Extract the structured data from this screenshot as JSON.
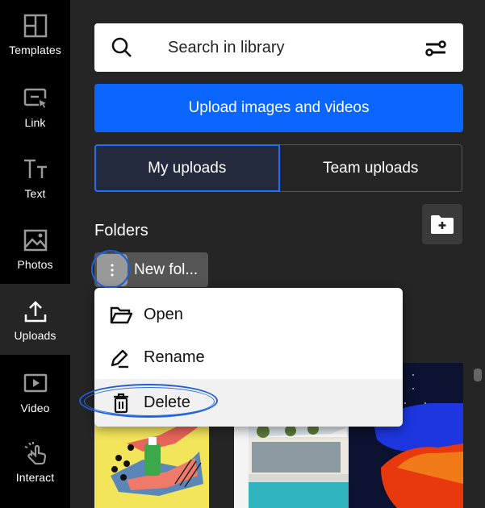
{
  "sidebar": {
    "items": [
      {
        "label": "Templates",
        "icon": "templates-icon",
        "active": false
      },
      {
        "label": "Link",
        "icon": "link-icon",
        "active": false
      },
      {
        "label": "Text",
        "icon": "text-icon",
        "active": false
      },
      {
        "label": "Photos",
        "icon": "photos-icon",
        "active": false
      },
      {
        "label": "Uploads",
        "icon": "upload-icon",
        "active": true
      },
      {
        "label": "Video",
        "icon": "video-icon",
        "active": false
      },
      {
        "label": "Interact",
        "icon": "interact-icon",
        "active": false
      }
    ]
  },
  "search": {
    "placeholder": "Search in library",
    "icon": "search-icon",
    "filter_icon": "filter-icon"
  },
  "upload_button": {
    "label": "Upload images and videos"
  },
  "tabs": [
    {
      "label": "My uploads",
      "active": true
    },
    {
      "label": "Team uploads",
      "active": false
    }
  ],
  "folders": {
    "title": "Folders",
    "add_folder_icon": "folder-plus-icon",
    "items": [
      {
        "name": "New fol..."
      }
    ]
  },
  "context_menu": {
    "items": [
      {
        "label": "Open",
        "icon": "folder-open-icon"
      },
      {
        "label": "Rename",
        "icon": "pencil-icon"
      },
      {
        "label": "Delete",
        "icon": "trash-icon",
        "highlighted": true
      }
    ]
  },
  "thumbnails": [
    {
      "description": "Hands with hand sanitizer bottle on yellow background"
    },
    {
      "description": "Modern house with swimming pool"
    },
    {
      "description": "Blue and red rhinoceros poster on dark background"
    }
  ],
  "colors": {
    "accent": "#0a66ff",
    "sidebar_bg": "#000000",
    "panel_bg": "#252525",
    "annotation": "#1f5fd6"
  }
}
